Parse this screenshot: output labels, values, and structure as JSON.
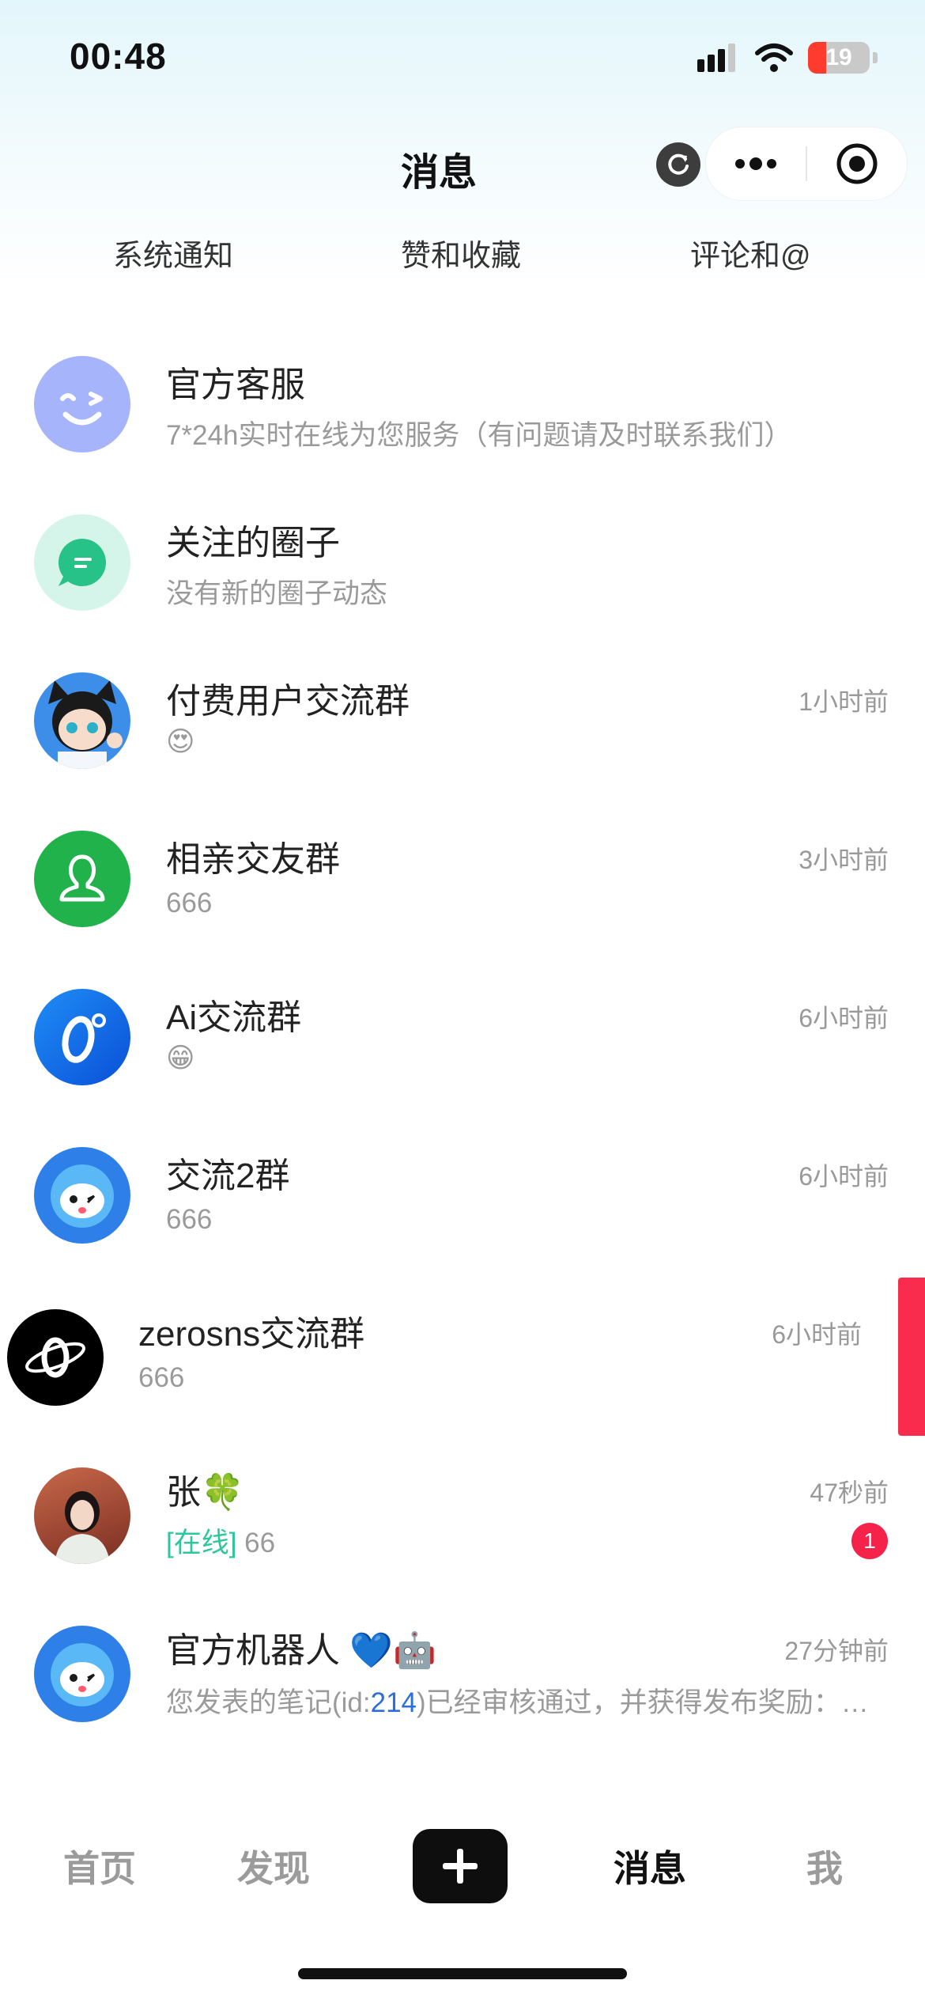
{
  "status_bar": {
    "time": "00:48",
    "battery": "19"
  },
  "nav": {
    "title": "消息"
  },
  "notification_tabs": [
    {
      "label": "系统通知"
    },
    {
      "label": "赞和收藏"
    },
    {
      "label": "评论和@"
    }
  ],
  "messages": [
    {
      "title": "官方客服",
      "preview": "7*24h实时在线为您服务（有问题请及时联系我们）",
      "time": ""
    },
    {
      "title": "关注的圈子",
      "preview": "没有新的圈子动态",
      "time": ""
    },
    {
      "title": "付费用户交流群",
      "preview": "😍",
      "time": "1小时前"
    },
    {
      "title": "相亲交友群",
      "preview": "666",
      "time": "3小时前"
    },
    {
      "title": "Ai交流群",
      "preview": "😁",
      "time": "6小时前"
    },
    {
      "title": "交流2群",
      "preview": "666",
      "time": "6小时前"
    },
    {
      "title": "zerosns交流群",
      "preview": "666",
      "time": "6小时前"
    },
    {
      "title": "张🍀",
      "status": "[在线]",
      "preview": " 66",
      "time": "47秒前",
      "unread": "1"
    },
    {
      "title": "官方机器人 💙🤖",
      "preview_a": "您发表的笔记(id:",
      "preview_id": "214",
      "preview_b": ")已经审核通过，并获得发布奖励：…",
      "time": "27分钟前"
    }
  ],
  "tabbar": {
    "home": "首页",
    "discover": "发现",
    "messages": "消息",
    "me": "我"
  },
  "colors": {
    "accent_red": "#f5224a",
    "online_green": "#2ec79d",
    "link_blue": "#2a6fdb"
  }
}
